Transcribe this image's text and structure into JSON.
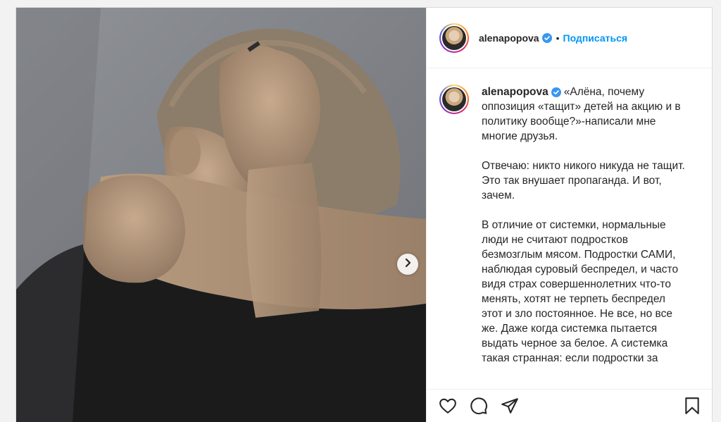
{
  "post": {
    "author": "alenapopova",
    "follow_label": "Подписаться",
    "separator": "•",
    "caption_paragraphs": [
      "«Алёна, почему оппозиция «тащит» детей на акцию и в политику вообще?»-написали мне многие друзья.",
      "Отвечаю: никто никого никуда не тащит. Это так внушает пропаганда. И вот, зачем.",
      "В отличие от системки, нормальные люди не считают подростков безмозглым мясом. Подростки САМИ, наблюдая суровый беспредел, и часто видя страх совершеннолетних что-то менять, хотят не терпеть беспредел этот и зло постоянное. Не все, но все же. Даже когда системка пытается выдать черное за белое. А системка такая странная: если подростки за"
    ]
  },
  "colors": {
    "link": "#0095f6",
    "verified": "#3897f0",
    "text": "#262626"
  },
  "icons": {
    "next": "chevron-right-icon",
    "like": "heart-icon",
    "comment": "comment-icon",
    "share": "paper-plane-icon",
    "save": "bookmark-icon",
    "verified": "verified-badge-icon"
  }
}
